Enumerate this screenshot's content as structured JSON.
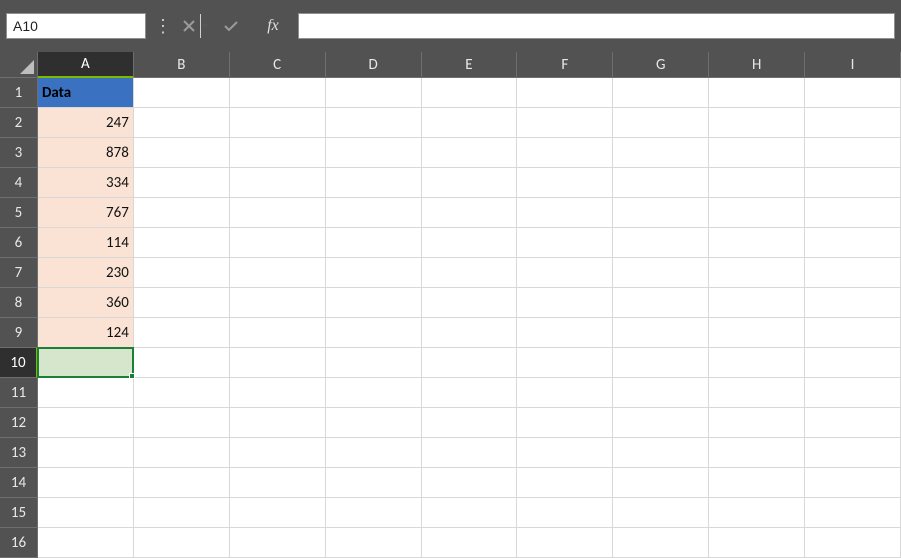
{
  "toolbar": {
    "namebox_value": "A10",
    "formula_value": ""
  },
  "columns": [
    "A",
    "B",
    "C",
    "D",
    "E",
    "F",
    "G",
    "H",
    "I"
  ],
  "active_column": "A",
  "active_row": 10,
  "visible_rows": 16,
  "cells": {
    "A1": {
      "value": "Data",
      "type": "header"
    },
    "A2": {
      "value": "247",
      "type": "data"
    },
    "A3": {
      "value": "878",
      "type": "data"
    },
    "A4": {
      "value": "334",
      "type": "data"
    },
    "A5": {
      "value": "767",
      "type": "data"
    },
    "A6": {
      "value": "114",
      "type": "data"
    },
    "A7": {
      "value": "230",
      "type": "data"
    },
    "A8": {
      "value": "360",
      "type": "data"
    },
    "A9": {
      "value": "124",
      "type": "data"
    }
  },
  "selected_cell": "A10"
}
